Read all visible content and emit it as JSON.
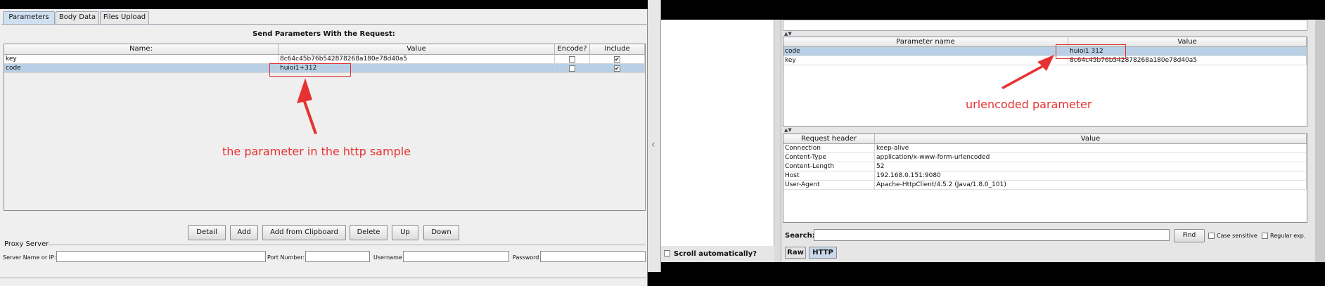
{
  "left": {
    "tabs": [
      "Parameters",
      "Body Data",
      "Files Upload"
    ],
    "section_title": "Send Parameters With the Request:",
    "columns": [
      "Name:",
      "Value",
      "Encode?",
      "Include Equals?"
    ],
    "rows": [
      {
        "name": "key",
        "value": "8c64c45b76b542878268a180e78d40a5",
        "encode": false,
        "include_equals": true
      },
      {
        "name": "code",
        "value": "huioi1+312",
        "encode": false,
        "include_equals": true
      }
    ],
    "buttons": [
      "Detail",
      "Add",
      "Add from Clipboard",
      "Delete",
      "Up",
      "Down"
    ],
    "proxy": {
      "title": "Proxy Server",
      "server_label": "Server Name or IP:",
      "port_label": "Port Number:",
      "username_label": "Username",
      "password_label": "Password"
    },
    "annotation": "the parameter in the http sample"
  },
  "right": {
    "scroll_auto_label": "Scroll automatically?",
    "params_columns": [
      "Parameter name",
      "Value"
    ],
    "params_rows": [
      {
        "name": "code",
        "value": "huioi1 312"
      },
      {
        "name": "key",
        "value": "8c64c45b76b542878268a180e78d40a5"
      }
    ],
    "annotation": "urlencoded parameter",
    "headers_columns": [
      "Request header",
      "Value"
    ],
    "headers_rows": [
      {
        "name": "Connection",
        "value": "keep-alive"
      },
      {
        "name": "Content-Type",
        "value": "application/x-www-form-urlencoded"
      },
      {
        "name": "Content-Length",
        "value": "52"
      },
      {
        "name": "Host",
        "value": "192.168.0.151:9080"
      },
      {
        "name": "User-Agent",
        "value": "Apache-HttpClient/4.5.2 (Java/1.8.0_101)"
      }
    ],
    "search_label": "Search:",
    "find_label": "Find",
    "case_sensitive_label": "Case sensitive",
    "regular_exp_label": "Regular exp.",
    "bottom_tabs": [
      "Raw",
      "HTTP"
    ]
  },
  "colors": {
    "annotation": "#e63232",
    "selected_row": "#b8cfe5",
    "active_tab": "#cfe0f2"
  }
}
